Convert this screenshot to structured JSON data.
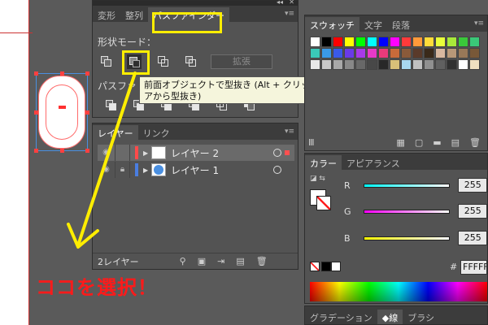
{
  "pathfinder": {
    "tabs": [
      "変形",
      "整列",
      "パスファインダー"
    ],
    "shape_mode_label": "形状モード：",
    "expand_label": "拡張",
    "pathfinder_label": "パスファ",
    "tooltip": "前面オブジェクトで型抜き (Alt + クリックで複合シェイプを作成し形状エリアから型抜き)"
  },
  "layers": {
    "tabs": [
      "レイヤー",
      "リンク"
    ],
    "rows": [
      {
        "name": "レイヤー 2",
        "color": "#ff4a4a"
      },
      {
        "name": "レイヤー 1",
        "color": "#4a7ee0"
      }
    ],
    "count_label": "2レイヤー"
  },
  "swatches": {
    "tabs": [
      "スウォッチ",
      "文字",
      "段落"
    ],
    "colors": [
      "#ffffff",
      "#000000",
      "#ff0000",
      "#ffff00",
      "#00ff00",
      "#00ffff",
      "#0000ff",
      "#ff00ff",
      "#ff3a3a",
      "#ff9a3a",
      "#ffdc3a",
      "#e8ff3a",
      "#a8e83a",
      "#3ac83a",
      "#3ac878",
      "#3ac8b8",
      "#3a9ae8",
      "#3a5ae8",
      "#6a3ae8",
      "#a83ae8",
      "#e83ac8",
      "#e83a7a",
      "#c86a3a",
      "#8a5a3a",
      "#5a3a2a",
      "#3a2a1a",
      "#d8b8a0",
      "#b89878",
      "#987858",
      "#785838",
      "#e8e8e8",
      "#c8c8c8",
      "#a8a8a8",
      "#888888",
      "#686868",
      "#484848",
      "#282828",
      "#d8c078",
      "#a8d8f0",
      "#c0c0c0",
      "#909090",
      "#606060",
      "#303030",
      "#ffffff",
      "#f0e0c0"
    ]
  },
  "color": {
    "tabs": [
      "カラー",
      "アピアランス"
    ],
    "channels": [
      {
        "label": "R",
        "value": "255",
        "gradient": "linear-gradient(to right, #00ffff, #ffffff)"
      },
      {
        "label": "G",
        "value": "255",
        "gradient": "linear-gradient(to right, #ff00ff, #ffffff)"
      },
      {
        "label": "B",
        "value": "255",
        "gradient": "linear-gradient(to right, #ffff00, #ffffff)"
      }
    ],
    "hex_label": "#",
    "hex_value": "FFFFF"
  },
  "bottom_tabs": [
    "グラデーション",
    "線",
    "ブラシ"
  ],
  "annotation": "ココを選択！"
}
